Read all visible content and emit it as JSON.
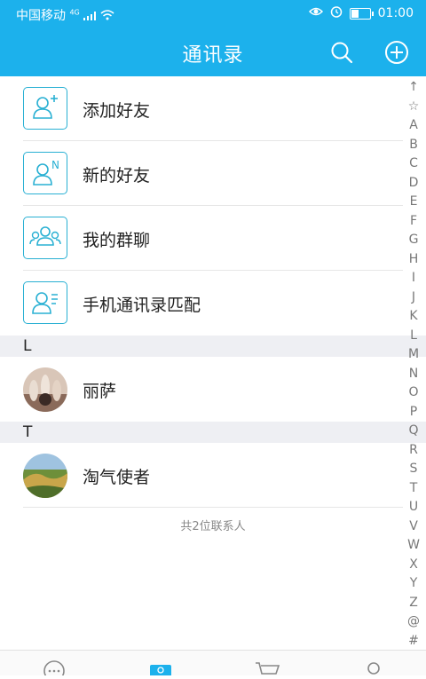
{
  "status_bar": {
    "carrier": "中国移动",
    "network": "4G",
    "time": "01:00",
    "battery_level": 0.45
  },
  "header": {
    "title": "通讯录",
    "search_icon": "search-icon",
    "add_icon": "plus-circle-icon",
    "accent_color": "#1cb1ec"
  },
  "quick_actions": [
    {
      "label": "添加好友",
      "icon": "add-friend-icon"
    },
    {
      "label": "新的好友",
      "icon": "new-friend-icon"
    },
    {
      "label": "我的群聊",
      "icon": "group-chat-icon"
    },
    {
      "label": "手机通讯录匹配",
      "icon": "phone-contacts-icon"
    }
  ],
  "sections": [
    {
      "letter": "L",
      "contacts": [
        {
          "name": "丽萨"
        }
      ]
    },
    {
      "letter": "T",
      "contacts": [
        {
          "name": "淘气使者"
        }
      ]
    }
  ],
  "contact_count_text": "共2位联系人",
  "index_letters": [
    "↑",
    "☆",
    "A",
    "B",
    "C",
    "D",
    "E",
    "F",
    "G",
    "H",
    "I",
    "J",
    "K",
    "L",
    "M",
    "N",
    "O",
    "P",
    "Q",
    "R",
    "S",
    "T",
    "U",
    "V",
    "W",
    "X",
    "Y",
    "Z",
    "@",
    "#"
  ],
  "tabs": [
    {
      "icon": "chat-icon"
    },
    {
      "icon": "contacts-icon"
    },
    {
      "icon": "shop-cart-icon"
    },
    {
      "icon": "profile-icon"
    }
  ]
}
